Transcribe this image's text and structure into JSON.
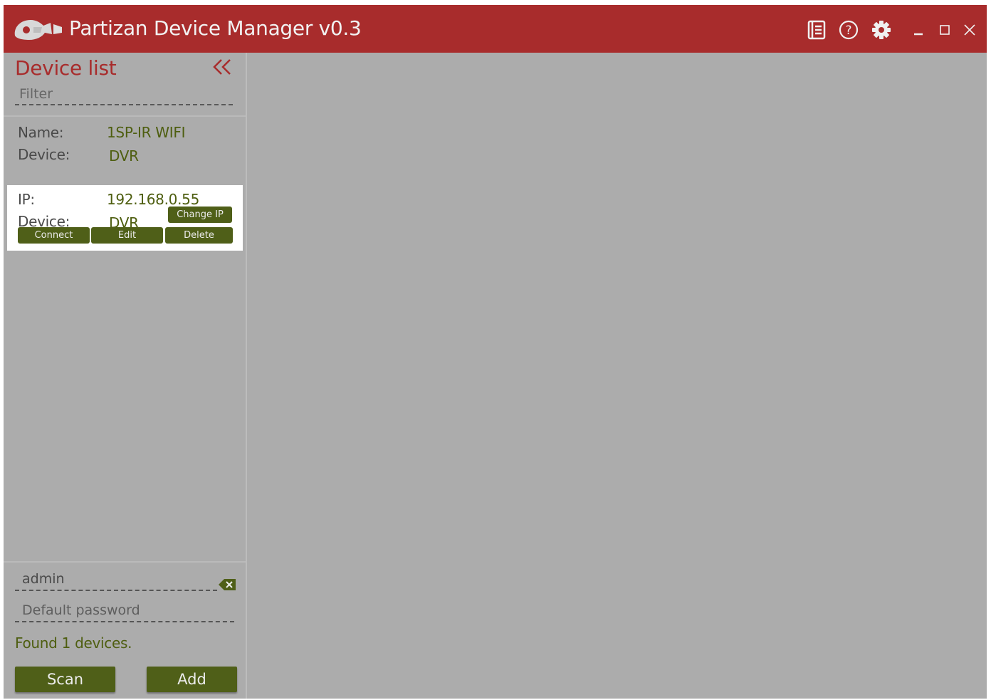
{
  "window": {
    "title": "Partizan Device Manager v0.3",
    "accent_color": "#a82c2c",
    "icons": [
      "logo-icon",
      "manual-icon",
      "help-icon",
      "settings-icon",
      "minimize-icon",
      "maximize-icon",
      "close-icon"
    ]
  },
  "sidebar": {
    "title": "Device list",
    "collapse_icon": "double-chevron-left-icon",
    "filter_placeholder": "Filter",
    "devices": [
      {
        "name_label": "Name:",
        "name_value": "1SP-IR WIFI",
        "device_label": "Device:",
        "device_value": "DVR"
      },
      {
        "ip_label": "IP:",
        "ip_value": "192.168.0.55",
        "device_label": "Device:",
        "device_value": "DVR",
        "change_ip_label": "Change IP",
        "connect_label": "Connect",
        "edit_label": "Edit",
        "delete_label": "Delete"
      }
    ],
    "username_value": "admin",
    "clear_icon": "backspace-clear-icon",
    "password_placeholder": "Default password",
    "status_text": "Found 1 devices.",
    "scan_label": "Scan",
    "add_label": "Add",
    "button_color": "#4f5f18"
  }
}
